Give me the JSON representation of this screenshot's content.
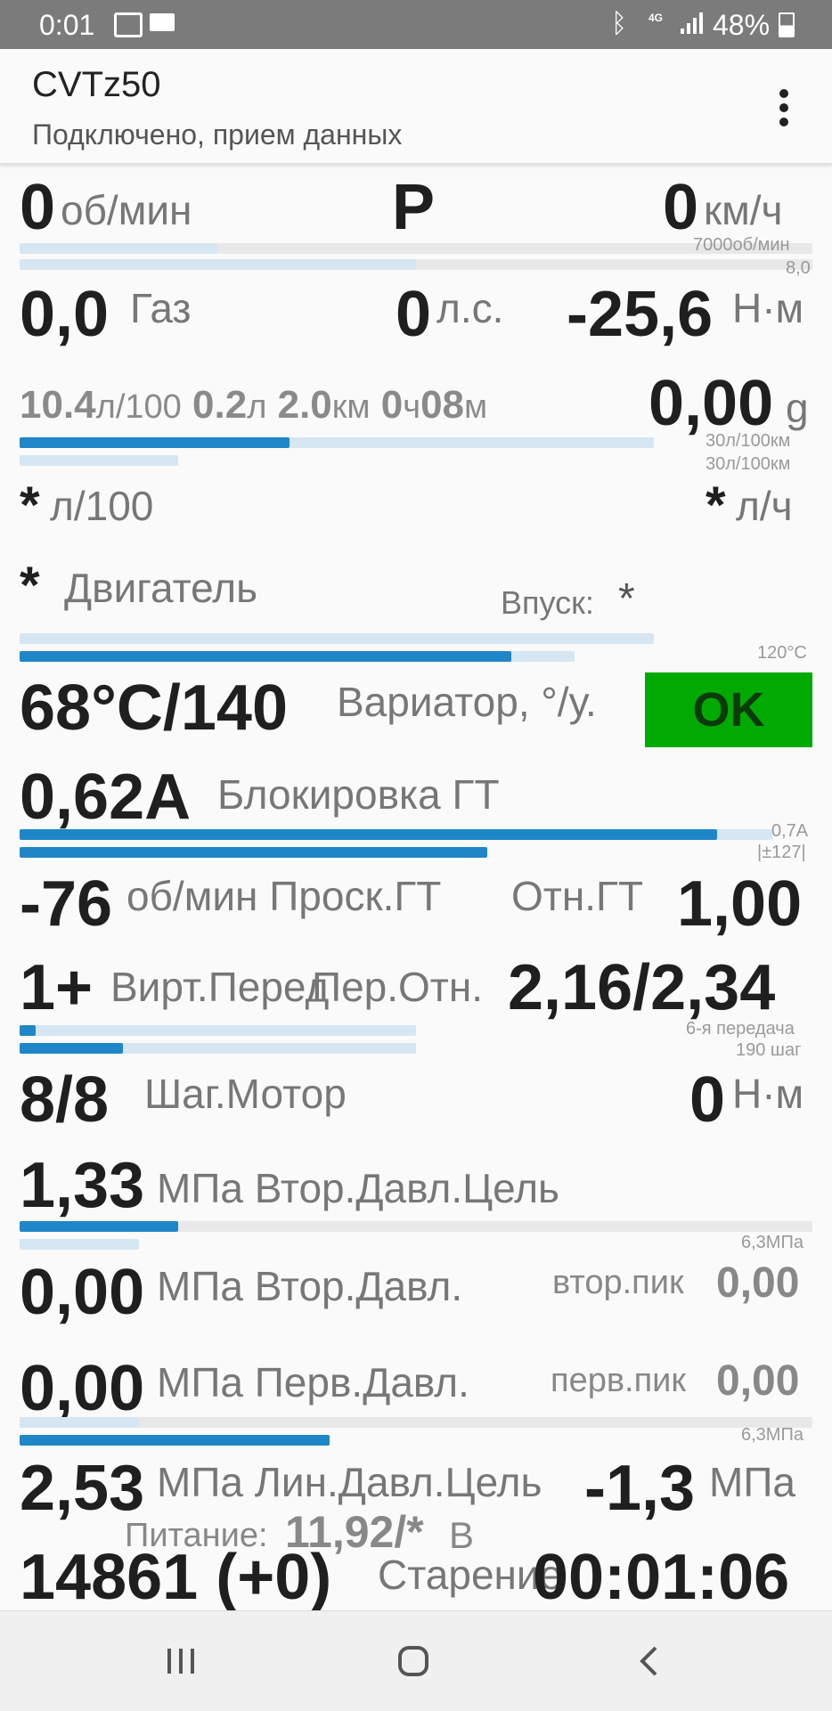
{
  "status": {
    "time": "0:01",
    "network": "4G",
    "battery": "48%"
  },
  "app": {
    "title": "CVTz50",
    "subtitle": "Подключено, прием данных"
  },
  "rows": {
    "rpm_value": "0",
    "rpm_unit": "об/мин",
    "gear_letter": "P",
    "speed_value": "0",
    "speed_unit": "км/ч",
    "rpm_max_label": "7000об/мин",
    "speed_max_label": "8,0",
    "throttle_value": "0,0",
    "throttle_label": "Газ",
    "power_value": "0",
    "power_unit": "л.с.",
    "torque_value": "-25,6",
    "torque_unit": "Н·м",
    "cons_avg": "10.4",
    "cons_avg_unit": "л/100",
    "fuel_used": "0.2",
    "fuel_used_unit": "л",
    "dist": "2.0",
    "dist_unit": "км",
    "time_h": "0",
    "time_h_unit": "ч",
    "time_m": "08",
    "time_m_unit": "м",
    "g_value": "0,00",
    "g_unit": "g",
    "cons_max1": "30л/100км",
    "cons_max2": "30л/100км",
    "inst_l100": "*",
    "inst_l100_unit": "л/100",
    "inst_lh": "*",
    "inst_lh_unit": "л/ч",
    "engine_value": "*",
    "engine_label": "Двигатель",
    "intake_label": "Впуск:",
    "intake_value": "*",
    "temp_max_label": "120°C",
    "cvt_temp_value": "68°C/140",
    "cvt_temp_label": "Вариатор, °/у.",
    "ok_label": "OK",
    "lockup_value": "0,62A",
    "lockup_label": "Блокировка ГТ",
    "lockup_max": "0,7A",
    "lockup_range": "|±127|",
    "slip_value": "-76",
    "slip_label": "об/мин Проск.ГТ",
    "tc_ratio_label": "Отн.ГТ",
    "tc_ratio_value": "1,00",
    "vgear_value": "1+",
    "vgear_label": "Вирт.Перед",
    "ratio_label": "Пер.Отн.",
    "ratio_value": "2,16/2,34",
    "gear_max_label": "6-я передача",
    "step_max_label": "190 шаг",
    "stepper_value": "8/8",
    "stepper_label": "Шаг.Мотор",
    "stepper_torque_value": "0",
    "stepper_torque_unit": "Н·м",
    "sec_target_value": "1,33",
    "sec_target_label": "МПа Втор.Давл.Цель",
    "sec_max_label": "6,3МПа",
    "sec_value": "0,00",
    "sec_label": "МПа Втор.Давл.",
    "sec_peak_label": "втор.пик",
    "sec_peak_value": "0,00",
    "pri_value": "0,00",
    "pri_label": "МПа Перв.Давл.",
    "pri_peak_label": "перв.пик",
    "pri_peak_value": "0,00",
    "pri_max_label": "6,3МПа",
    "line_value": "2,53",
    "line_label": "МПа Лин.Давл.Цель",
    "line_value2": "-1,3",
    "line_unit2": "МПа",
    "power_supply_label": "Питание:",
    "power_supply_value": "11,92/*",
    "power_supply_unit": "В",
    "aging_value": "14861 (+0)",
    "aging_label": "Старение",
    "timer_value": "00:01:06"
  },
  "bars": {
    "rpm": 0.0,
    "speed": 0.0,
    "consumption": 0.3,
    "engine_temp": 0.6,
    "intake_temp": 0.0,
    "lockup": 0.94,
    "lockup_range": 0.6,
    "gear": 0.02,
    "step": 0.13,
    "sec_target": 0.2,
    "pri": 0.4
  }
}
